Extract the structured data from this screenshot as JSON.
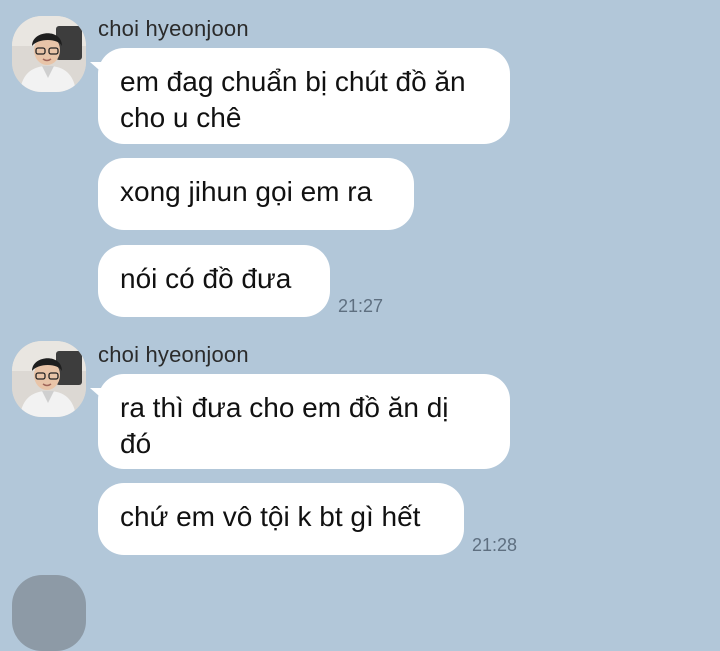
{
  "groups": [
    {
      "sender": "choi hyeonjoon",
      "avatar_icon": "profile-photo-icon",
      "messages": [
        {
          "text_line1": "em đag chuẩn bị chút đồ ăn",
          "text_line2": "cho u chê"
        },
        {
          "text": "xong jihun gọi em ra"
        },
        {
          "text": "nói có đồ đưa"
        }
      ],
      "time": "21:27"
    },
    {
      "sender": "choi hyeonjoon",
      "avatar_icon": "profile-photo-icon",
      "messages": [
        {
          "text_line1": "ra thì đưa cho em đồ ăn dị",
          "text_line2": "đó"
        },
        {
          "text": "chứ em vô tội k bt gì hết"
        }
      ],
      "time": "21:28"
    }
  ],
  "colors": {
    "background": "#b2c7d9",
    "bubble": "#ffffff",
    "time": "#5e6f80"
  }
}
